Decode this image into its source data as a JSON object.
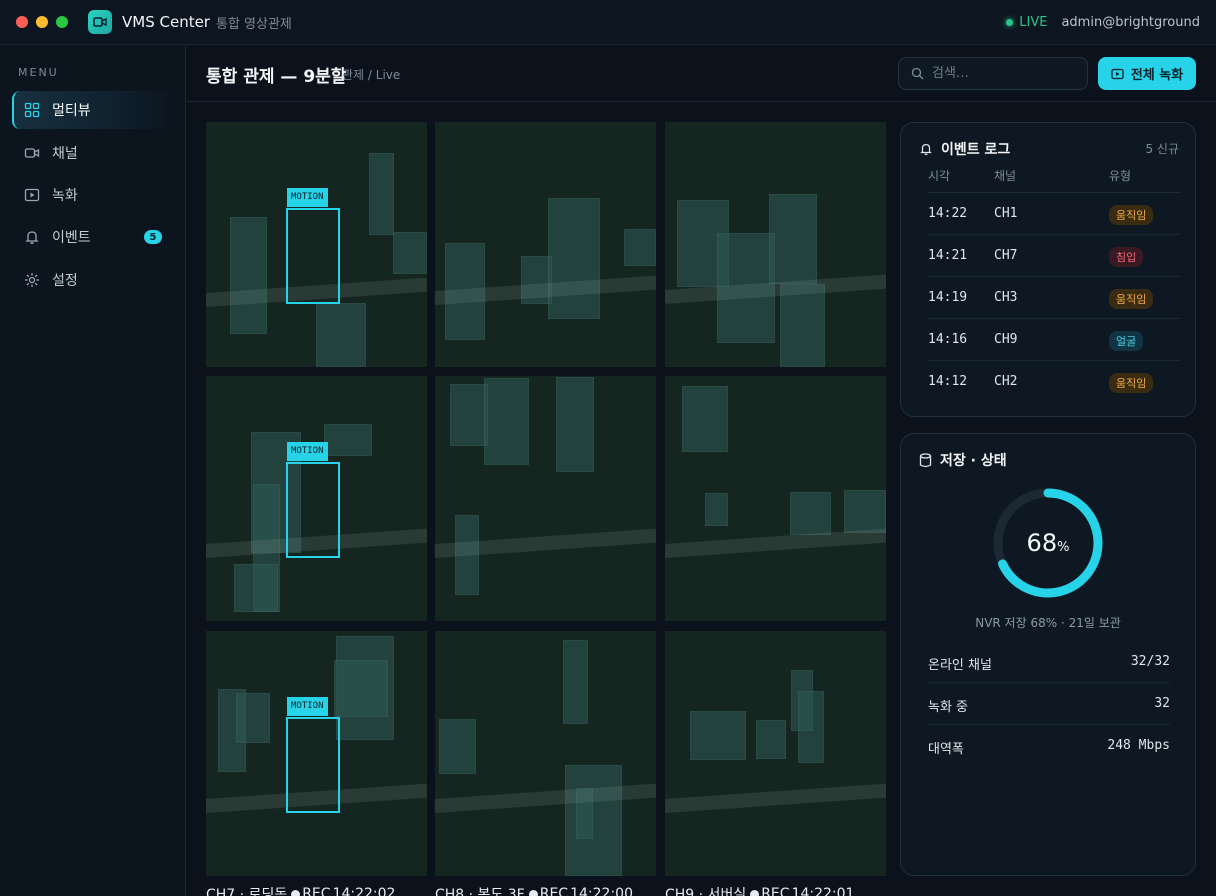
{
  "app": {
    "name": "VMS Center",
    "subtitle": "통합 영상관제",
    "live_label": "LIVE",
    "user": "admin@brightground"
  },
  "sidebar": {
    "menu_label": "MENU",
    "items": [
      {
        "label": "멀티뷰",
        "icon": "grid-icon",
        "active": true
      },
      {
        "label": "채널",
        "icon": "camera-icon"
      },
      {
        "label": "녹화",
        "icon": "play-icon"
      },
      {
        "label": "이벤트",
        "icon": "bell-icon",
        "badge": "5"
      },
      {
        "label": "설정",
        "icon": "gear-icon"
      }
    ]
  },
  "header": {
    "title": "통합 관제 — 9분할",
    "breadcrumb": "관제 / Live",
    "search_placeholder": "검색…",
    "record_all_label": "전체 녹화"
  },
  "cameras": [
    {
      "label": "",
      "rec": "",
      "time": "",
      "motion": "MOTION"
    },
    {
      "label": "",
      "rec": "",
      "time": ""
    },
    {
      "label": "",
      "rec": "",
      "time": ""
    },
    {
      "label": "",
      "rec": "",
      "time": "",
      "motion": "MOTION"
    },
    {
      "label": "",
      "rec": "",
      "time": ""
    },
    {
      "label": "",
      "rec": "",
      "time": ""
    },
    {
      "label": "CH7 · 로딩독",
      "rec": "REC",
      "time": "14:22:02",
      "motion": "MOTION"
    },
    {
      "label": "CH8 · 복도 3F",
      "rec": "REC",
      "time": "14:22:00"
    },
    {
      "label": "CH9 · 서버실",
      "rec": "REC",
      "time": "14:22:01"
    }
  ],
  "events": {
    "title": "이벤트 로그",
    "new_count": "5 신규",
    "columns": [
      "시각",
      "채널",
      "유형"
    ],
    "rows": [
      {
        "time": "14:22",
        "channel": "CH1",
        "type": "움직임"
      },
      {
        "time": "14:21",
        "channel": "CH7",
        "type": "침입"
      },
      {
        "time": "14:19",
        "channel": "CH3",
        "type": "움직임"
      },
      {
        "time": "14:16",
        "channel": "CH9",
        "type": "얼굴"
      },
      {
        "time": "14:12",
        "channel": "CH2",
        "type": "움직임"
      }
    ]
  },
  "storage": {
    "title": "저장 · 상태",
    "percent": "68",
    "percent_value": 0.68,
    "unit": "%",
    "caption": "NVR 저장 68% · 21일 보관",
    "stats": [
      {
        "key": "온라인 채널",
        "value": "32/32"
      },
      {
        "key": "녹화 중",
        "value": "32"
      },
      {
        "key": "대역폭",
        "value": "248 Mbps"
      }
    ]
  },
  "colors": {
    "accent": "#27d3e8",
    "live": "#2bc48a",
    "motion_pill": "#f1a845",
    "intrusion_pill": "#f0637a",
    "face_pill": "#3fd0e6"
  }
}
